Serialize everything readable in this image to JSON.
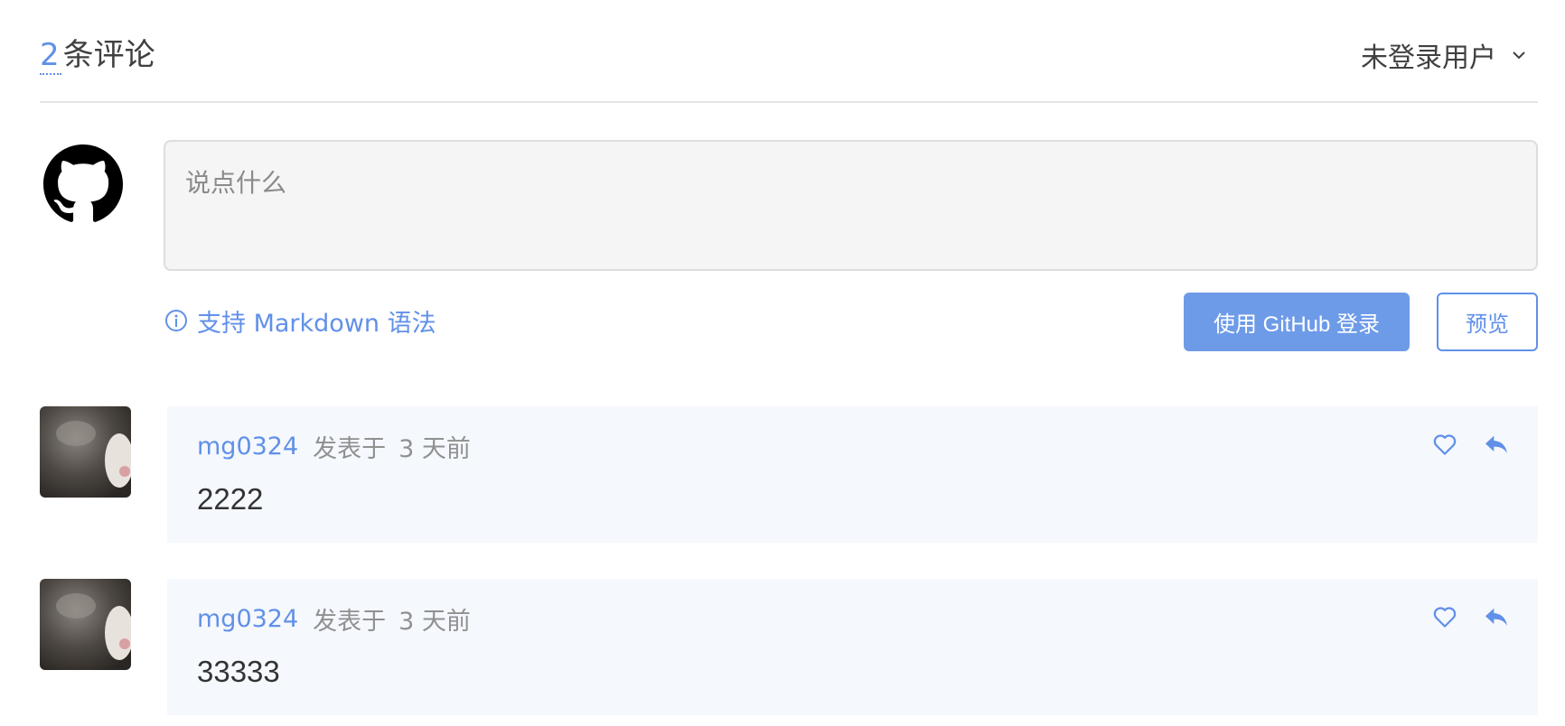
{
  "header": {
    "count": "2",
    "count_label": "条评论",
    "user_menu_label": "未登录用户"
  },
  "editor": {
    "placeholder": "说点什么",
    "value": "",
    "markdown_tip": "支持 Markdown 语法",
    "login_button": "使用 GitHub 登录",
    "preview_button": "预览"
  },
  "comments": [
    {
      "author": "mg0324",
      "posted_label": "发表于",
      "time": "3 天前",
      "body": "2222"
    },
    {
      "author": "mg0324",
      "posted_label": "发表于",
      "time": "3 天前",
      "body": "33333"
    }
  ],
  "icons": {
    "editor_avatar": "github-icon",
    "user_menu": "chevron-down-icon",
    "tip": "info-icon",
    "like": "heart-icon",
    "reply": "reply-icon"
  },
  "colors": {
    "accent": "#6190e8",
    "button_bg": "#6d9be8",
    "card_bg": "#f5f8fd",
    "textarea_bg": "#f5f5f5"
  }
}
